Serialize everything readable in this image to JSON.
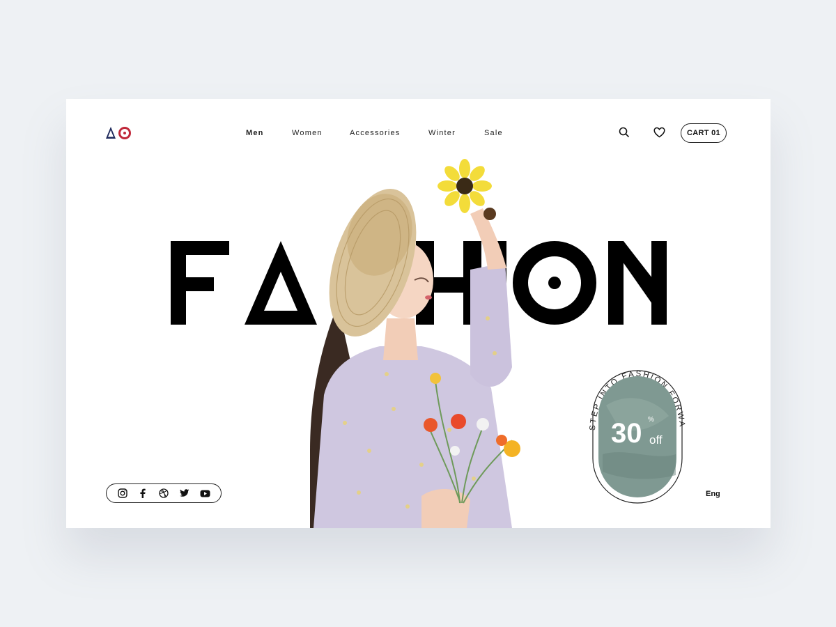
{
  "header": {
    "logo_icons": [
      "triangle-icon",
      "circle-dot-icon"
    ],
    "nav": [
      "Men",
      "Women",
      "Accessories",
      "Winter",
      "Sale"
    ],
    "active_nav": "Men",
    "cart_label": "CART 01"
  },
  "hero": {
    "headline": "FASHION",
    "badge_caption": "STEP INTO FASHION FORWARD",
    "discount": "30",
    "discount_symbol": "%",
    "discount_suffix": "off"
  },
  "footer": {
    "social_icons": [
      "instagram-icon",
      "facebook-icon",
      "dribbble-icon",
      "twitter-icon",
      "youtube-icon"
    ],
    "language": "Eng"
  },
  "colors": {
    "page_bg": "#eef1f4",
    "card_bg": "#ffffff",
    "logo_blue": "#1f2a5c",
    "logo_red": "#c0283a",
    "badge_fill": "#7f9992",
    "text": "#111111"
  }
}
